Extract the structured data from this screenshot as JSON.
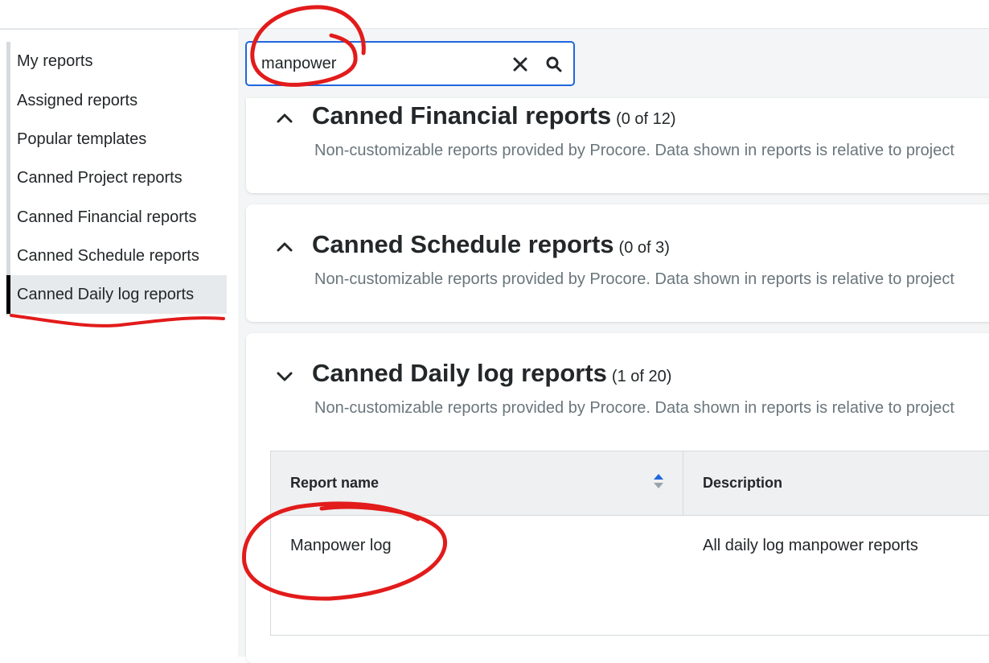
{
  "sidebar": {
    "items": [
      {
        "label": "My reports"
      },
      {
        "label": "Assigned reports"
      },
      {
        "label": "Popular templates"
      },
      {
        "label": "Canned Project reports"
      },
      {
        "label": "Canned Financial reports"
      },
      {
        "label": "Canned Schedule reports"
      },
      {
        "label": "Canned Daily log reports"
      }
    ],
    "active_index": 6
  },
  "search": {
    "value": "manpower"
  },
  "sections": [
    {
      "title": "Canned Financial reports",
      "count": "(0 of 12)",
      "description": "Non-customizable reports provided by Procore. Data shown in reports is relative to project",
      "expanded": true
    },
    {
      "title": "Canned Schedule reports",
      "count": "(0 of 3)",
      "description": "Non-customizable reports provided by Procore. Data shown in reports is relative to project",
      "expanded": true
    },
    {
      "title": "Canned Daily log reports",
      "count": "(1 of 20)",
      "description": "Non-customizable reports provided by Procore. Data shown in reports is relative to project",
      "expanded": false
    }
  ],
  "table": {
    "columns": [
      "Report name",
      "Description"
    ],
    "rows": [
      {
        "name": "Manpower log",
        "description": "All daily log manpower reports"
      }
    ]
  },
  "colors": {
    "accent": "#2066df",
    "annotation": "#e21b1b",
    "active_bar": "#000000"
  },
  "icons": {
    "clear": "close-icon",
    "search": "search-icon",
    "collapse": "chevron-up-icon",
    "expand": "chevron-down-icon",
    "sort": "sort-icon"
  }
}
